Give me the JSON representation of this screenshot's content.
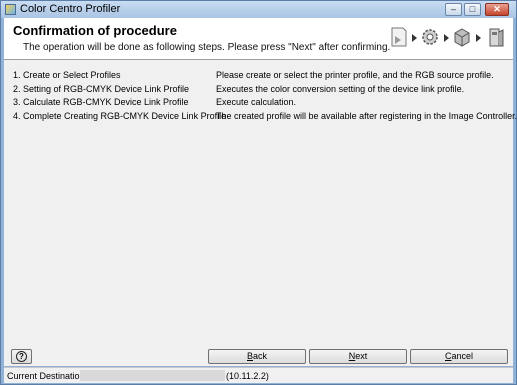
{
  "window": {
    "title": "Color Centro Profiler",
    "minimize_icon": "minimize-icon",
    "maximize_icon": "maximize-icon",
    "close_icon": "close-icon"
  },
  "header": {
    "title": "Confirmation of procedure",
    "subtitle": "The operation will be done as following steps. Please press \"Next\" after confirming.",
    "step_icons": [
      "printer-profile-icon",
      "gear-icon",
      "cube-icon",
      "controller-icon"
    ]
  },
  "steps": [
    {
      "name": "1. Create or Select Profiles",
      "description": "Please create or select the printer profile, and the RGB source profile."
    },
    {
      "name": "2. Setting of RGB-CMYK Device Link Profile",
      "description": "Executes the color conversion setting of the device link profile."
    },
    {
      "name": "3. Calculate RGB-CMYK Device Link Profile",
      "description": "Execute calculation."
    },
    {
      "name": "4. Complete Creating RGB-CMYK Device Link Profile",
      "description": "The created profile will be available after registering in the Image Controller."
    }
  ],
  "buttons": {
    "help_icon": "help-icon",
    "back": {
      "accel": "B",
      "rest": "ack"
    },
    "next": {
      "accel": "N",
      "rest": "ext"
    },
    "cancel": {
      "accel": "C",
      "rest": "ancel"
    }
  },
  "status": {
    "label": "Current Destination",
    "address": "(10.11.2.2)"
  },
  "colors": {
    "window_frame": "#8fb2d6",
    "client_bg": "#f0f0f0",
    "header_bg": "#ffffff"
  }
}
